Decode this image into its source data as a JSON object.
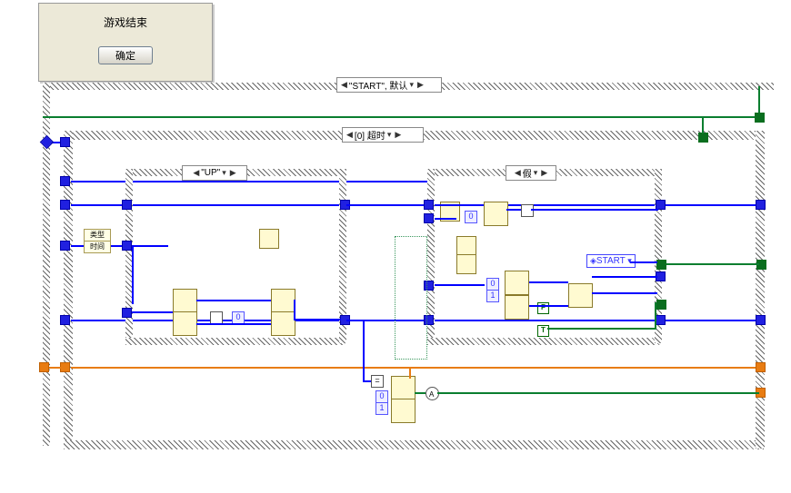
{
  "dialog": {
    "title": "游戏结束",
    "ok": "确定"
  },
  "selector_outer": "\"START\", 默认",
  "selector_event": "[0] 超时",
  "selector_left": "\"UP\"",
  "selector_right": "假",
  "unbundle_a": "类型",
  "unbundle_b": "时间",
  "const0": "0",
  "const1": "1",
  "enumStart": "START",
  "boolF": "F",
  "boolT": "T",
  "eq": "="
}
